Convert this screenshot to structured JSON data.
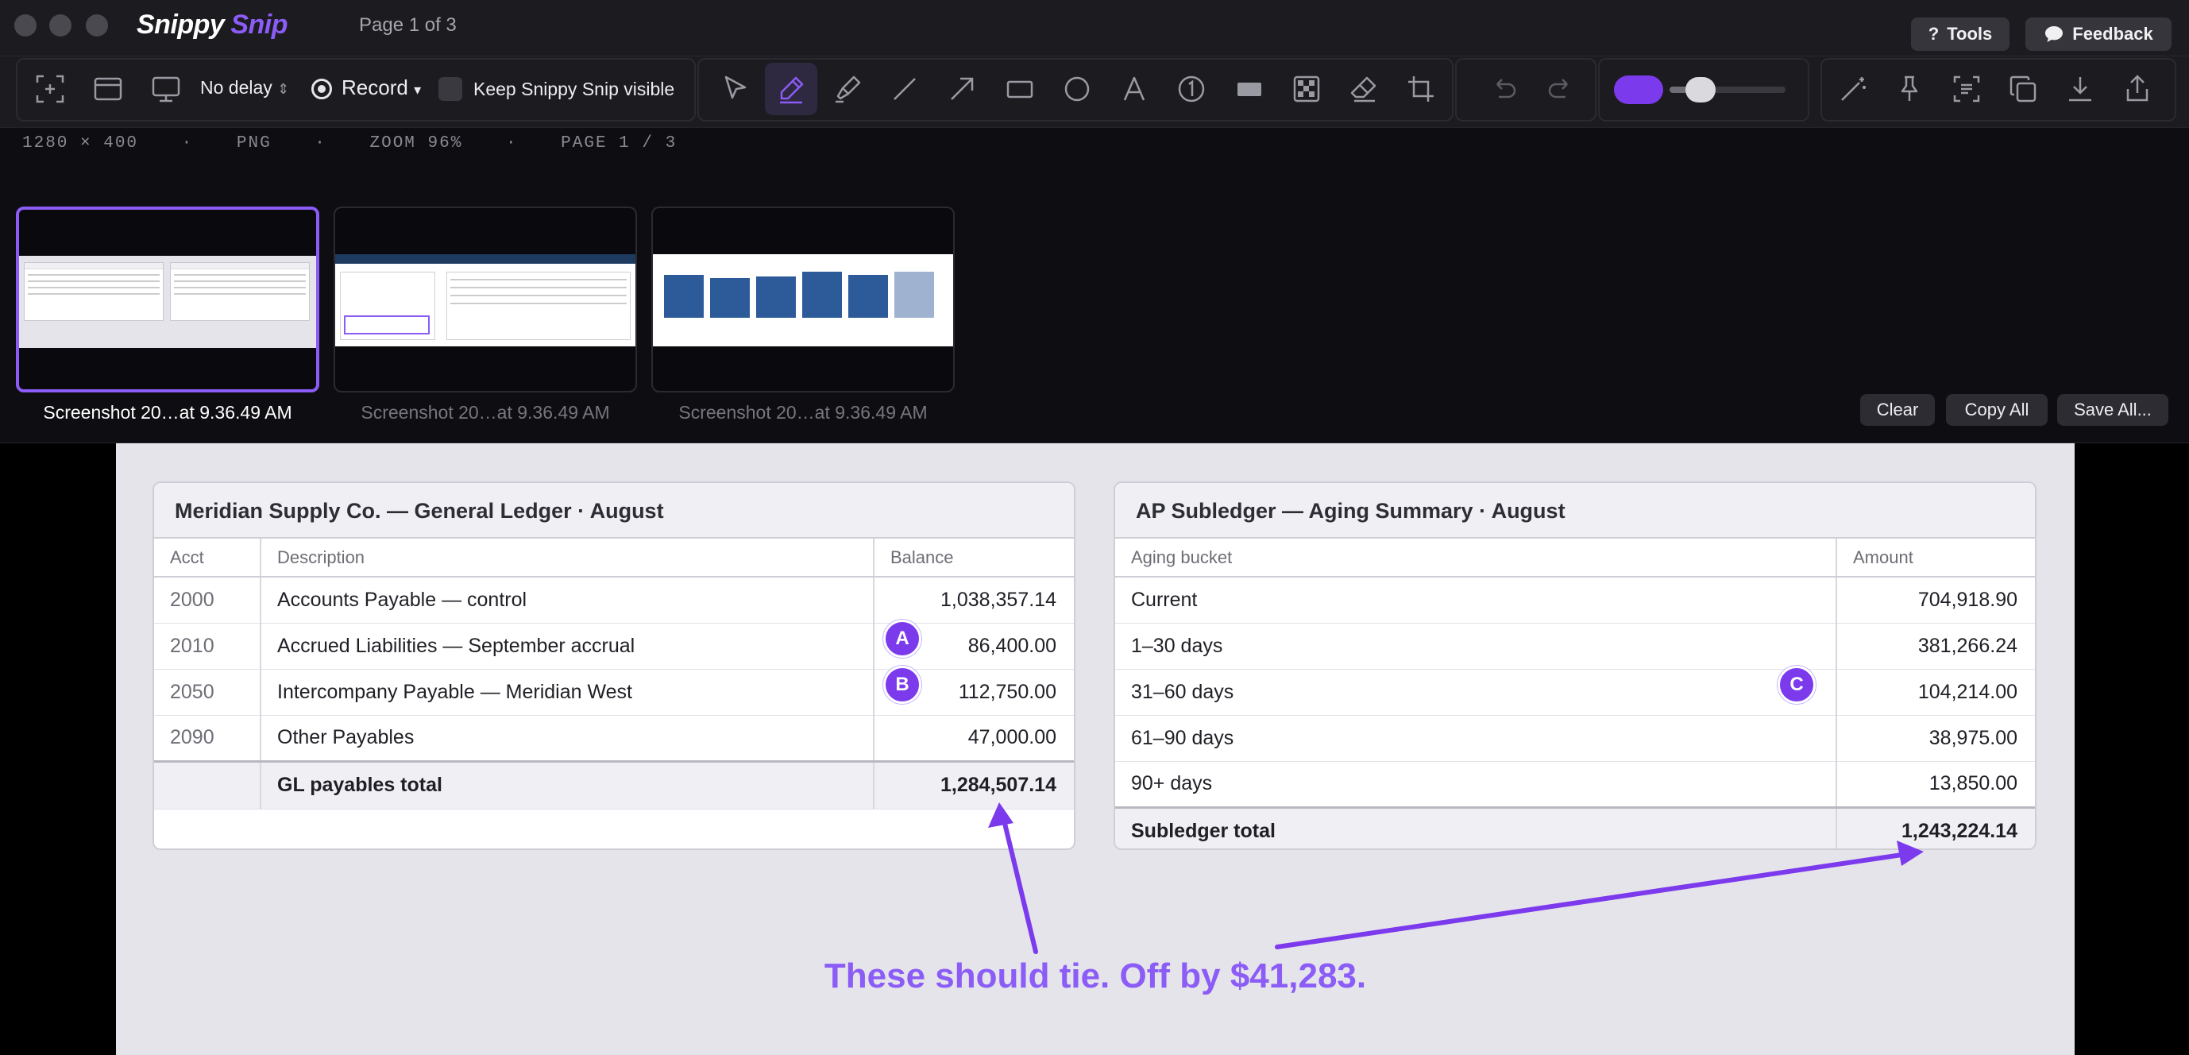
{
  "window": {
    "brand_primary": "Snippy",
    "brand_secondary": "Snip",
    "page_indicator": "Page 1 of 3",
    "tools_label": "Tools",
    "tools_icon": "?",
    "feedback_label": "Feedback"
  },
  "toolbar": {
    "delay_label": "No delay",
    "record_label": "Record",
    "keep_visible_label": "Keep Snippy Snip visible",
    "color_swatch": "#7c3aed"
  },
  "info": {
    "dimensions": "1280 × 400",
    "format": "PNG",
    "zoom": "ZOOM 96%",
    "page": "PAGE 1 / 3"
  },
  "thumbnails": [
    {
      "label": "Screenshot 20…at 9.36.49 AM",
      "selected": true
    },
    {
      "label": "Screenshot 20…at 9.36.49 AM",
      "selected": false
    },
    {
      "label": "Screenshot 20…at 9.36.49 AM",
      "selected": false
    }
  ],
  "strip_actions": {
    "clear": "Clear",
    "copy_all": "Copy All",
    "save_all": "Save All..."
  },
  "gl": {
    "title": "Meridian Supply Co. — General Ledger · August",
    "headers": [
      "Acct",
      "Description",
      "Balance"
    ],
    "rows": [
      {
        "acct": "2000",
        "desc": "Accounts Payable — control",
        "balance": "1,038,357.14"
      },
      {
        "acct": "2010",
        "desc": "Accrued Liabilities — September accrual",
        "balance": "86,400.00"
      },
      {
        "acct": "2050",
        "desc": "Intercompany Payable — Meridian West",
        "balance": "112,750.00"
      },
      {
        "acct": "2090",
        "desc": "Other Payables",
        "balance": "47,000.00"
      }
    ],
    "total_label": "GL payables total",
    "total_value": "1,284,507.14"
  },
  "ap": {
    "title": "AP Subledger — Aging Summary · August",
    "headers": [
      "Aging bucket",
      "Amount"
    ],
    "rows": [
      {
        "bucket": "Current",
        "amount": "704,918.90"
      },
      {
        "bucket": "1–30 days",
        "amount": "381,266.24"
      },
      {
        "bucket": "31–60 days",
        "amount": "104,214.00"
      },
      {
        "bucket": "61–90 days",
        "amount": "38,975.00"
      },
      {
        "bucket": "90+ days",
        "amount": "13,850.00"
      }
    ],
    "total_label": "Subledger total",
    "total_value": "1,243,224.14"
  },
  "badges": {
    "a": "A",
    "b": "B",
    "c": "C"
  },
  "annotation_text": "These should tie. Off by $41,283.",
  "colors": {
    "accent": "#8b5cf6",
    "badge": "#7c3aed"
  }
}
